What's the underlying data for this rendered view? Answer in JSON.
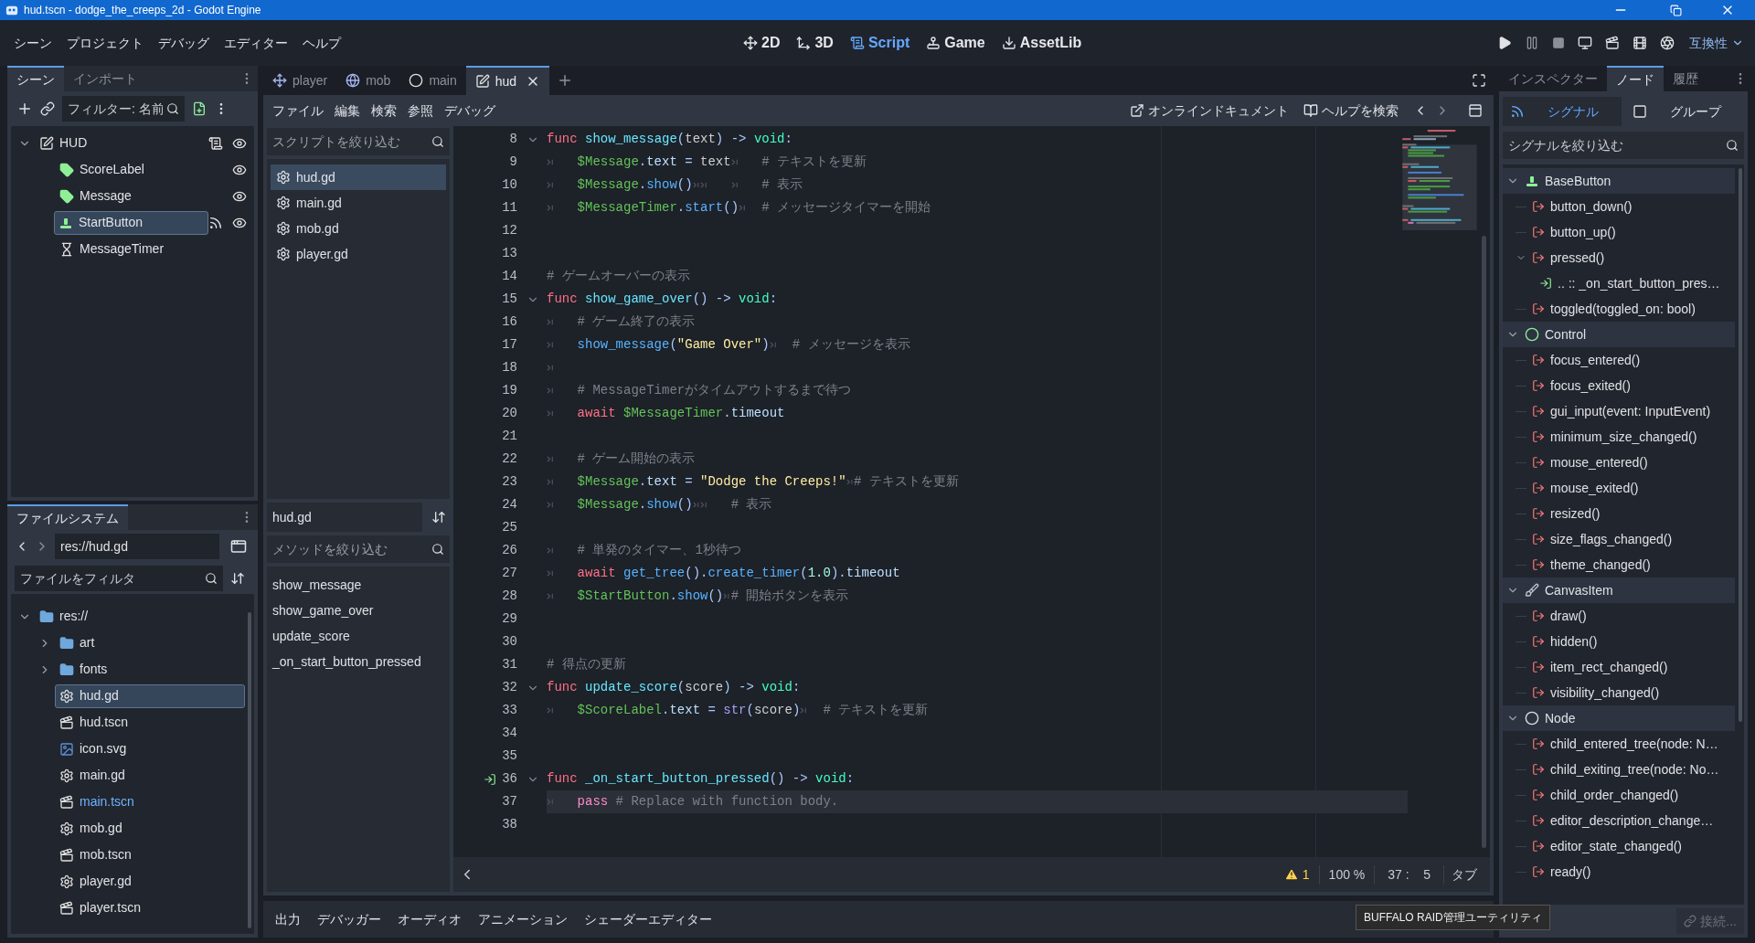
{
  "window": {
    "title": "hud.tscn - dodge_the_creeps_2d - Godot Engine"
  },
  "menu": [
    "シーン",
    "プロジェクト",
    "デバッグ",
    "エディター",
    "ヘルプ"
  ],
  "workspaces": [
    {
      "label": "2D",
      "kind": "canvas",
      "selected": false
    },
    {
      "label": "3D",
      "kind": "spatial",
      "selected": false
    },
    {
      "label": "Script",
      "kind": "script",
      "selected": true
    },
    {
      "label": "Game",
      "kind": "game",
      "selected": false
    },
    {
      "label": "AssetLib",
      "kind": "assetlib",
      "selected": false
    }
  ],
  "renderer": "互換性",
  "scene_dock": {
    "tabs": [
      {
        "label": "シーン",
        "selected": true
      },
      {
        "label": "インポート",
        "selected": false
      }
    ],
    "filter_placeholder": "フィルター: 名前",
    "tree": {
      "name": "HUD",
      "kind": "control",
      "expanded": true,
      "selected": false,
      "script": true,
      "signals": false,
      "visible": true,
      "children": [
        {
          "name": "ScoreLabel",
          "kind": "label",
          "selected": false,
          "script": false,
          "signals": false,
          "visible": true
        },
        {
          "name": "Message",
          "kind": "label",
          "selected": false,
          "script": false,
          "signals": false,
          "visible": true
        },
        {
          "name": "StartButton",
          "kind": "button",
          "selected": true,
          "script": false,
          "signals": true,
          "visible": true
        },
        {
          "name": "MessageTimer",
          "kind": "timer",
          "selected": false,
          "script": false,
          "signals": false
        }
      ]
    }
  },
  "filesystem": {
    "tab": "ファイルシステム",
    "path": "res://hud.gd",
    "filter_placeholder": "ファイルをフィルタ",
    "tree": {
      "name": "res://",
      "kind": "folder",
      "expanded": true,
      "selected": false,
      "main_scene": false,
      "children": [
        {
          "name": "art",
          "kind": "folder",
          "expanded": false,
          "selected": false,
          "main_scene": false
        },
        {
          "name": "fonts",
          "kind": "folder",
          "expanded": false,
          "selected": false,
          "main_scene": false
        },
        {
          "name": "hud.gd",
          "kind": "script",
          "selected": true,
          "main_scene": false
        },
        {
          "name": "hud.tscn",
          "kind": "scene",
          "selected": false,
          "main_scene": false
        },
        {
          "name": "icon.svg",
          "kind": "image",
          "selected": false,
          "main_scene": false
        },
        {
          "name": "main.gd",
          "kind": "script",
          "selected": false,
          "main_scene": false
        },
        {
          "name": "main.tscn",
          "kind": "scene",
          "selected": false,
          "main_scene": true
        },
        {
          "name": "mob.gd",
          "kind": "script",
          "selected": false,
          "main_scene": false
        },
        {
          "name": "mob.tscn",
          "kind": "scene",
          "selected": false,
          "main_scene": false
        },
        {
          "name": "player.gd",
          "kind": "script",
          "selected": false,
          "main_scene": false
        },
        {
          "name": "player.tscn",
          "kind": "scene",
          "selected": false,
          "main_scene": false
        }
      ]
    }
  },
  "editor_tabs": [
    {
      "label": "player",
      "kind": "character",
      "selected": false
    },
    {
      "label": "mob",
      "kind": "rigidbody",
      "selected": false
    },
    {
      "label": "main",
      "kind": "node",
      "selected": false
    },
    {
      "label": "hud",
      "kind": "control",
      "selected": true
    }
  ],
  "script_menu": [
    "ファイル",
    "編集",
    "検索",
    "参照",
    "デバッグ"
  ],
  "help_links": [
    {
      "label": "オンラインドキュメント",
      "kind": "docs"
    },
    {
      "label": "ヘルプを検索",
      "kind": "search"
    }
  ],
  "script_list": {
    "filter_placeholder": "スクリプトを絞り込む",
    "items": [
      {
        "name": "hud.gd",
        "selected": true
      },
      {
        "name": "main.gd",
        "selected": false
      },
      {
        "name": "mob.gd",
        "selected": false
      },
      {
        "name": "player.gd",
        "selected": false
      }
    ],
    "current": "hud.gd",
    "method_filter_placeholder": "メソッドを絞り込む",
    "methods": [
      "show_message",
      "show_game_over",
      "update_score",
      "_on_start_button_pressed"
    ]
  },
  "code": {
    "lines": [
      {
        "n": "8",
        "fold": true,
        "tokens": [
          {
            "text": "func ",
            "kind": "kw"
          },
          {
            "text": "show_message",
            "kind": "def"
          },
          {
            "text": "(",
            "kind": "sym"
          },
          {
            "text": "text",
            "kind": "plain"
          },
          {
            "text": ") -> ",
            "kind": "sym"
          },
          {
            "text": "void",
            "kind": "type"
          },
          {
            "text": ":",
            "kind": "sym"
          }
        ]
      },
      {
        "n": "9",
        "tokens": [
          {
            "kind": "tab"
          },
          {
            "text": "$Message",
            "kind": "node"
          },
          {
            "text": ".",
            "kind": "sym"
          },
          {
            "text": "text",
            "kind": "member"
          },
          {
            "text": " = ",
            "kind": "sym"
          },
          {
            "text": "text",
            "kind": "plain"
          },
          {
            "kind": "tab"
          },
          {
            "text": "# テキストを更新",
            "kind": "cmt"
          }
        ]
      },
      {
        "n": "10",
        "tokens": [
          {
            "kind": "tab"
          },
          {
            "text": "$Message",
            "kind": "node"
          },
          {
            "text": ".",
            "kind": "sym"
          },
          {
            "text": "show",
            "kind": "call"
          },
          {
            "text": "()",
            "kind": "sym"
          },
          {
            "kind": "tab"
          },
          {
            "kind": "tab"
          },
          {
            "kind": "tab"
          },
          {
            "text": "# 表示",
            "kind": "cmt"
          }
        ]
      },
      {
        "n": "11",
        "tokens": [
          {
            "kind": "tab"
          },
          {
            "text": "$MessageTimer",
            "kind": "node"
          },
          {
            "text": ".",
            "kind": "sym"
          },
          {
            "text": "start",
            "kind": "call"
          },
          {
            "text": "()",
            "kind": "sym"
          },
          {
            "kind": "tab"
          },
          {
            "text": "# メッセージタイマーを開始",
            "kind": "cmt"
          }
        ]
      },
      {
        "n": "12"
      },
      {
        "n": "13"
      },
      {
        "n": "14",
        "tokens": [
          {
            "text": "# ゲームオーバーの表示",
            "kind": "cmt"
          }
        ]
      },
      {
        "n": "15",
        "fold": true,
        "tokens": [
          {
            "text": "func ",
            "kind": "kw"
          },
          {
            "text": "show_game_over",
            "kind": "def"
          },
          {
            "text": "() -> ",
            "kind": "sym"
          },
          {
            "text": "void",
            "kind": "type"
          },
          {
            "text": ":",
            "kind": "sym"
          }
        ]
      },
      {
        "n": "16",
        "tokens": [
          {
            "kind": "tab"
          },
          {
            "text": "# ゲーム終了の表示",
            "kind": "cmt"
          }
        ]
      },
      {
        "n": "17",
        "tokens": [
          {
            "kind": "tab"
          },
          {
            "text": "show_message",
            "kind": "call"
          },
          {
            "text": "(",
            "kind": "sym"
          },
          {
            "text": "\"Game Over\"",
            "kind": "str"
          },
          {
            "text": ")",
            "kind": "sym"
          },
          {
            "kind": "tab"
          },
          {
            "text": "# メッセージを表示",
            "kind": "cmt"
          }
        ]
      },
      {
        "n": "18",
        "tokens": [
          {
            "kind": "tab"
          }
        ]
      },
      {
        "n": "19",
        "tokens": [
          {
            "kind": "tab"
          },
          {
            "text": "# MessageTimerがタイムアウトするまで待つ",
            "kind": "cmt"
          }
        ]
      },
      {
        "n": "20",
        "tokens": [
          {
            "kind": "tab"
          },
          {
            "text": "await ",
            "kind": "kw"
          },
          {
            "text": "$MessageTimer",
            "kind": "node"
          },
          {
            "text": ".",
            "kind": "sym"
          },
          {
            "text": "timeout",
            "kind": "member"
          }
        ]
      },
      {
        "n": "21"
      },
      {
        "n": "22",
        "tokens": [
          {
            "kind": "tab"
          },
          {
            "text": "# ゲーム開始の表示",
            "kind": "cmt"
          }
        ]
      },
      {
        "n": "23",
        "tokens": [
          {
            "kind": "tab"
          },
          {
            "text": "$Message",
            "kind": "node"
          },
          {
            "text": ".",
            "kind": "sym"
          },
          {
            "text": "text",
            "kind": "member"
          },
          {
            "text": " = ",
            "kind": "sym"
          },
          {
            "text": "\"Dodge the Creeps!\"",
            "kind": "str"
          },
          {
            "kind": "tab"
          },
          {
            "text": "# テキストを更新",
            "kind": "cmt"
          }
        ]
      },
      {
        "n": "24",
        "tokens": [
          {
            "kind": "tab"
          },
          {
            "text": "$Message",
            "kind": "node"
          },
          {
            "text": ".",
            "kind": "sym"
          },
          {
            "text": "show",
            "kind": "call"
          },
          {
            "text": "()",
            "kind": "sym"
          },
          {
            "kind": "tab"
          },
          {
            "kind": "tab"
          },
          {
            "text": "# 表示",
            "kind": "cmt"
          }
        ]
      },
      {
        "n": "25"
      },
      {
        "n": "26",
        "tokens": [
          {
            "kind": "tab"
          },
          {
            "text": "# 単発のタイマー、1秒待つ",
            "kind": "cmt"
          }
        ]
      },
      {
        "n": "27",
        "tokens": [
          {
            "kind": "tab"
          },
          {
            "text": "await ",
            "kind": "kw"
          },
          {
            "text": "get_tree",
            "kind": "call"
          },
          {
            "text": "().",
            "kind": "sym"
          },
          {
            "text": "create_timer",
            "kind": "call"
          },
          {
            "text": "(",
            "kind": "sym"
          },
          {
            "text": "1.0",
            "kind": "num"
          },
          {
            "text": ").",
            "kind": "sym"
          },
          {
            "text": "timeout",
            "kind": "member"
          }
        ]
      },
      {
        "n": "28",
        "tokens": [
          {
            "kind": "tab"
          },
          {
            "text": "$StartButton",
            "kind": "node"
          },
          {
            "text": ".",
            "kind": "sym"
          },
          {
            "text": "show",
            "kind": "call"
          },
          {
            "text": "()",
            "kind": "sym"
          },
          {
            "kind": "tab"
          },
          {
            "text": "# 開始ボタンを表示",
            "kind": "cmt"
          }
        ]
      },
      {
        "n": "29"
      },
      {
        "n": "30"
      },
      {
        "n": "31",
        "tokens": [
          {
            "text": "# 得点の更新",
            "kind": "cmt"
          }
        ]
      },
      {
        "n": "32",
        "fold": true,
        "tokens": [
          {
            "text": "func ",
            "kind": "kw"
          },
          {
            "text": "update_score",
            "kind": "def"
          },
          {
            "text": "(",
            "kind": "sym"
          },
          {
            "text": "score",
            "kind": "plain"
          },
          {
            "text": ") -> ",
            "kind": "sym"
          },
          {
            "text": "void",
            "kind": "type"
          },
          {
            "text": ":",
            "kind": "sym"
          }
        ]
      },
      {
        "n": "33",
        "tokens": [
          {
            "kind": "tab"
          },
          {
            "text": "$ScoreLabel",
            "kind": "node"
          },
          {
            "text": ".",
            "kind": "sym"
          },
          {
            "text": "text",
            "kind": "member"
          },
          {
            "text": " = ",
            "kind": "sym"
          },
          {
            "text": "str",
            "kind": "builtin"
          },
          {
            "text": "(",
            "kind": "sym"
          },
          {
            "text": "score",
            "kind": "plain"
          },
          {
            "text": ")",
            "kind": "sym"
          },
          {
            "kind": "tab"
          },
          {
            "text": "# テキストを更新",
            "kind": "cmt"
          }
        ]
      },
      {
        "n": "34"
      },
      {
        "n": "35"
      },
      {
        "n": "36",
        "fold": true,
        "signal": true,
        "tokens": [
          {
            "text": "func ",
            "kind": "kw"
          },
          {
            "text": "_on_start_button_pressed",
            "kind": "def"
          },
          {
            "text": "() -> ",
            "kind": "sym"
          },
          {
            "text": "void",
            "kind": "type"
          },
          {
            "text": ":",
            "kind": "sym"
          }
        ]
      },
      {
        "n": "37",
        "current": true,
        "tokens": [
          {
            "kind": "tab"
          },
          {
            "text": "pass ",
            "kind": "ctrl"
          },
          {
            "text": "# Replace with function body.",
            "kind": "cmt"
          }
        ]
      },
      {
        "n": "38"
      }
    ]
  },
  "status": {
    "warnings": "1",
    "zoom": "100 %",
    "cursor": "37 :    5",
    "indent": "タブ"
  },
  "bottom_tabs": [
    "出力",
    "デバッガー",
    "オーディオ",
    "アニメーション",
    "シェーダーエディター"
  ],
  "tooltip": "BUFFALO RAID管理ユーティリティ",
  "node_dock": {
    "tabs": [
      {
        "label": "インスペクター",
        "selected": false
      },
      {
        "label": "ノード",
        "selected": true
      },
      {
        "label": "履歴",
        "selected": false
      }
    ],
    "subtabs": [
      {
        "label": "シグナル",
        "kind": "signals",
        "selected": true
      },
      {
        "label": "グループ",
        "kind": "groups",
        "selected": false
      }
    ],
    "filter_placeholder": "シグナルを絞り込む",
    "groups": [
      {
        "name": "BaseButton",
        "kind": "button",
        "expanded": true,
        "signals": [
          {
            "name": "button_down()"
          },
          {
            "name": "button_up()"
          },
          {
            "name": "pressed()",
            "expanded": true,
            "connections": [
              ".. :: _on_start_button_pres…"
            ]
          },
          {
            "name": "toggled(toggled_on: bool)"
          }
        ]
      },
      {
        "name": "Control",
        "kind": "control",
        "expanded": true,
        "signals": [
          {
            "name": "focus_entered()"
          },
          {
            "name": "focus_exited()"
          },
          {
            "name": "gui_input(event: InputEvent)"
          },
          {
            "name": "minimum_size_changed()"
          },
          {
            "name": "mouse_entered()"
          },
          {
            "name": "mouse_exited()"
          },
          {
            "name": "resized()"
          },
          {
            "name": "size_flags_changed()"
          },
          {
            "name": "theme_changed()"
          }
        ]
      },
      {
        "name": "CanvasItem",
        "kind": "canvasitem",
        "expanded": true,
        "signals": [
          {
            "name": "draw()"
          },
          {
            "name": "hidden()"
          },
          {
            "name": "item_rect_changed()"
          },
          {
            "name": "visibility_changed()"
          }
        ]
      },
      {
        "name": "Node",
        "kind": "node",
        "expanded": true,
        "signals": [
          {
            "name": "child_entered_tree(node: N…"
          },
          {
            "name": "child_exiting_tree(node: No…"
          },
          {
            "name": "child_order_changed()"
          },
          {
            "name": "editor_description_change…"
          },
          {
            "name": "editor_state_changed()"
          },
          {
            "name": "ready()"
          }
        ]
      }
    ],
    "connect": {
      "label": "接続...",
      "disabled": true
    }
  }
}
